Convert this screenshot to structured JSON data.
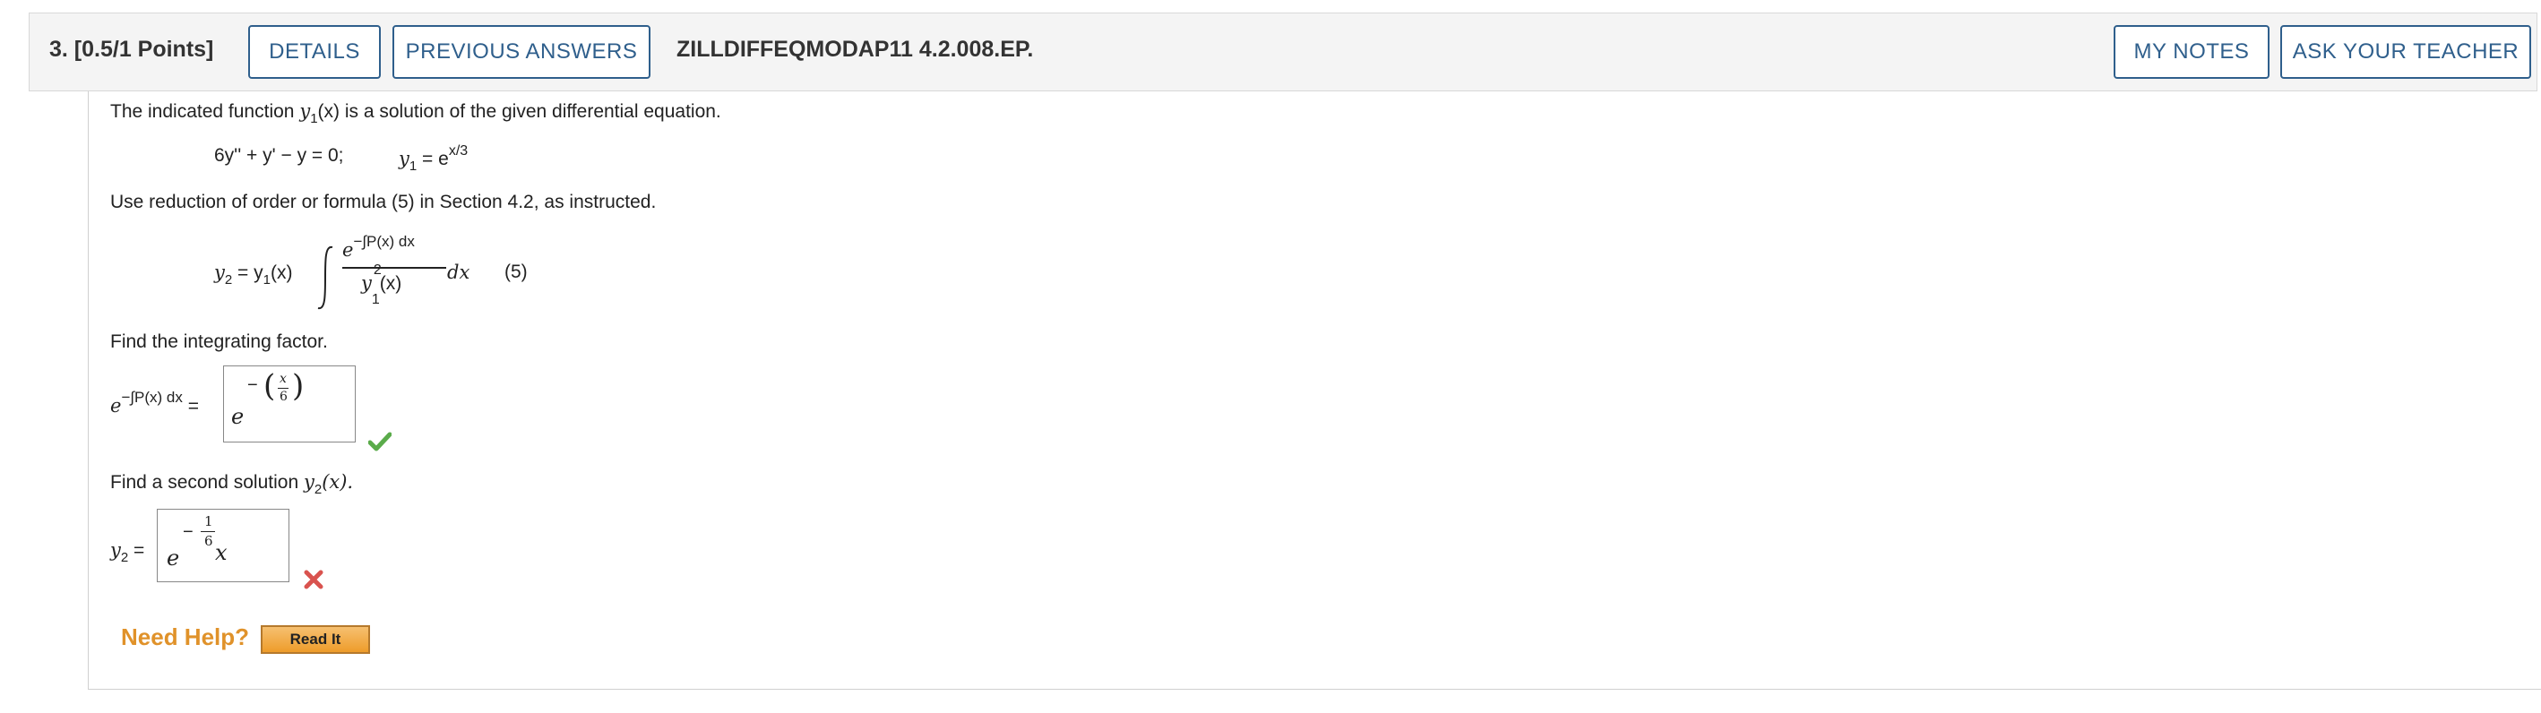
{
  "question": {
    "number_points": "3.  [0.5/1 Points]",
    "details_label": "DETAILS",
    "previous_answers_label": "PREVIOUS ANSWERS",
    "problem_code": "ZILLDIFFEQMODAP11 4.2.008.EP.",
    "my_notes_label": "MY NOTES",
    "ask_teacher_label": "ASK YOUR TEACHER"
  },
  "body": {
    "intro_pre": "The indicated function ",
    "intro_post": " is a solution of the given differential equation.",
    "y1_symbol": "y",
    "y1_sub": "1",
    "y1_arg": "(x)",
    "equation": "6y'' + y' − y = 0;",
    "y1_eq_lhs": "y",
    "y1_eq_sub": "1",
    "y1_eq_mid": " = e",
    "y1_eq_sup": "x/3",
    "instruction": "Use reduction of order or formula (5) in Section 4.2, as instructed.",
    "formula_lhs": "y",
    "formula_lhs_sub": "2",
    "formula_eq": " = y",
    "formula_eq_sub": "1",
    "formula_eq_arg": "(x)",
    "formula_num_base": "e",
    "formula_num_sup": "−∫P(x) dx",
    "formula_den_y": "y",
    "formula_den_sup": "2",
    "formula_den_sub": "1",
    "formula_den_arg": "(x)",
    "formula_dx": "dx",
    "formula_number": "(5)"
  },
  "part1": {
    "prompt": "Find the integrating factor.",
    "label_base": "e",
    "label_sup": "−∫P(x) dx",
    "label_eq": " =",
    "answer_base": "e",
    "answer_exp_sign": "−",
    "answer_num": "x",
    "answer_den": "6",
    "status": "correct"
  },
  "part2": {
    "prompt_pre": "Find a second solution ",
    "prompt_y": "y",
    "prompt_sub": "2",
    "prompt_post": "(x).",
    "label": "y",
    "label_sub": "2",
    "label_eq": " =",
    "answer_base": "e",
    "answer_exp_sign": "−",
    "answer_num": "1",
    "answer_den": "6",
    "answer_var": "x",
    "status": "incorrect"
  },
  "help": {
    "label": "Need Help?",
    "read_it_label": "Read It"
  },
  "colors": {
    "button_border": "#2f5f8c",
    "check": "#5aab4a",
    "cross": "#d9534f",
    "help_orange": "#e0922a"
  }
}
